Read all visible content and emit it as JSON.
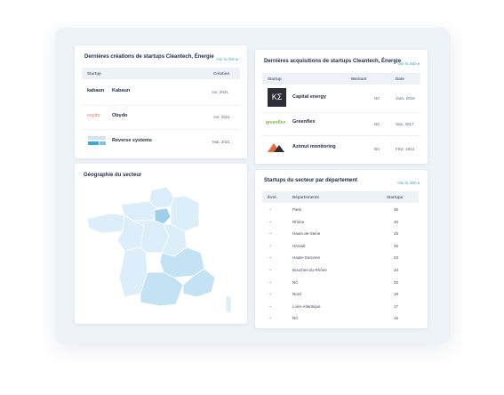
{
  "creations": {
    "title": "Dernières créations de startups Cleantech, Énergie",
    "link": "Voir la liste ▸",
    "headers": [
      "Startup",
      "Création"
    ],
    "rows": [
      {
        "logo": "kabaun",
        "name": "Kabaun",
        "date": "Avr. 2021"
      },
      {
        "logo": "oxydo",
        "name": "Obydo",
        "date": "Avr. 2021"
      },
      {
        "logo": "icon",
        "name": "Reverse systems",
        "date": "Mai. 2021"
      }
    ]
  },
  "acquisitions": {
    "title": "Dernières acquisitions de startups Cleantech, Énergie",
    "link": "Voir la liste ▸",
    "headers": [
      "Startup",
      "Montant",
      "Date"
    ],
    "rows": [
      {
        "logo": "KΣ",
        "name": "Capital energy",
        "amount": "NC",
        "date": "Janv. 2019"
      },
      {
        "logo": "greenflex",
        "name": "Greenflex",
        "amount": "NC",
        "date": "Sep. 2017"
      },
      {
        "logo": "azimut",
        "name": "Azimut monitoring",
        "amount": "NC",
        "date": "Févr. 2014"
      }
    ]
  },
  "geography": {
    "title": "Géographie du secteur"
  },
  "departments": {
    "title": "Startups du secteur par département",
    "link": "Voir la liste ▸",
    "headers": [
      "Évol.",
      "Départements",
      "Startups"
    ],
    "rows": [
      {
        "arrow": "→",
        "name": "Paris",
        "count": "35"
      },
      {
        "arrow": "→",
        "name": "Rhône",
        "count": "30"
      },
      {
        "arrow": "→",
        "name": "Hauts-de-Seine",
        "count": "25"
      },
      {
        "arrow": "→",
        "name": "Hérault",
        "count": "25"
      },
      {
        "arrow": "→",
        "name": "Haute-Garonne",
        "count": "23"
      },
      {
        "arrow": "→",
        "name": "Bouches-du-Rhône",
        "count": "23"
      },
      {
        "arrow": "→",
        "name": "NC",
        "count": "20"
      },
      {
        "arrow": "→",
        "name": "Nord",
        "count": "19"
      },
      {
        "arrow": "→",
        "name": "Loire-Atlantique",
        "count": "17"
      },
      {
        "arrow": "→",
        "name": "NC",
        "count": "15"
      }
    ]
  },
  "colors": {
    "accent": "#3aa7e0",
    "map_light": "#dbeef9",
    "map_mid": "#c3e3f5",
    "map_dark": "#9fcfeb"
  }
}
